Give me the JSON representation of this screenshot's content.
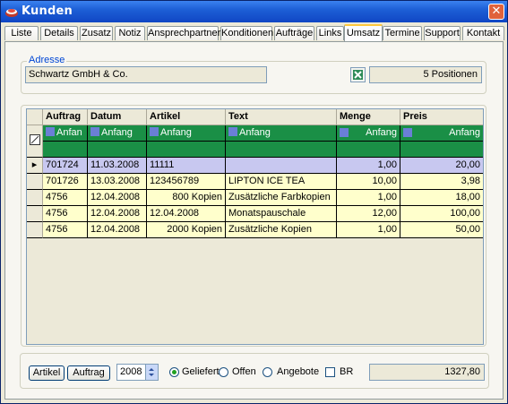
{
  "window": {
    "title": "Kunden",
    "close_label": "✕"
  },
  "tabs": [
    {
      "label": "Liste"
    },
    {
      "label": "Details"
    },
    {
      "label": "Zusatz"
    },
    {
      "label": "Notiz"
    },
    {
      "label": "Ansprechpartner"
    },
    {
      "label": "Konditionen"
    },
    {
      "label": "Aufträge"
    },
    {
      "label": "Links"
    },
    {
      "label": "Umsatz"
    },
    {
      "label": "Termine"
    },
    {
      "label": "Support"
    },
    {
      "label": "Kontakt"
    }
  ],
  "active_tab": "Umsatz",
  "address": {
    "group_title": "Adresse",
    "value": "Schwartz GmbH  & Co.",
    "positions": "5 Positionen"
  },
  "grid": {
    "columns": [
      "Auftrag",
      "Datum",
      "Artikel",
      "Text",
      "Menge",
      "Preis"
    ],
    "filter": [
      "Anfan",
      "Anfang",
      "Anfang",
      "Anfang",
      "Anfang",
      "Anfang"
    ],
    "rows": [
      [
        "701724",
        "11.03.2008",
        "11111",
        "",
        "1,00",
        "20,00"
      ],
      [
        "701726",
        "13.03.2008",
        "123456789",
        "LIPTON ICE TEA",
        "10,00",
        "3,98"
      ],
      [
        "4756",
        "12.04.2008",
        "800 Kopien",
        "Zusätzliche Farbkopien",
        "1,00",
        "18,00"
      ],
      [
        "4756",
        "12.04.2008",
        "12.04.2008",
        "Monatspauschale",
        "12,00",
        "100,00"
      ],
      [
        "4756",
        "12.04.2008",
        "2000 Kopien",
        "Zusätzliche Kopien",
        "1,00",
        "50,00"
      ]
    ],
    "selected_row": 0
  },
  "bottom": {
    "artikel_button": "Artikel",
    "auftrag_button": "Auftrag",
    "year": "2008",
    "radio_geliefert": "Geliefert",
    "radio_offen": "Offen",
    "radio_angebote": "Angebote",
    "selected_radio": "Geliefert",
    "checkbox_br": "BR",
    "total": "1327,80"
  },
  "colors": {
    "titlebar": "#1d5fd6",
    "filter_row": "#1a8f46",
    "selected_row": "#c8c8f0",
    "data_row": "#ffffcc",
    "group_title": "#0046d5"
  }
}
